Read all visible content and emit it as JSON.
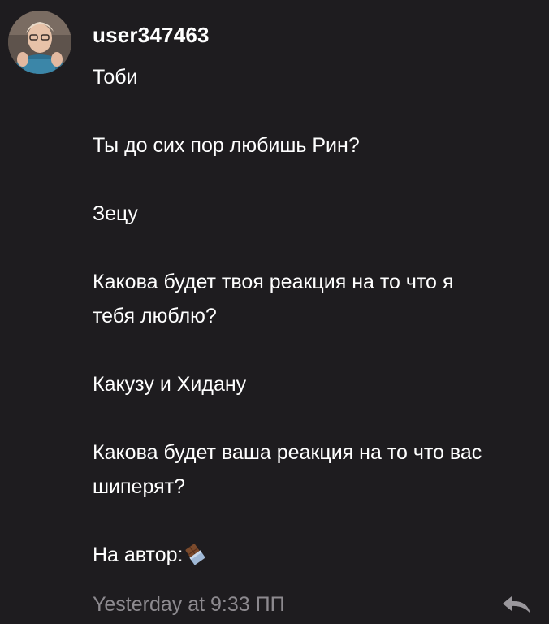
{
  "comment": {
    "username": "user347463",
    "lines": [
      "Тоби",
      "Ты до сих пор любишь Рин?",
      "Зецу",
      "Какова будет твоя реакция на то что я",
      "тебя люблю?",
      "Какузу и Хидану",
      "Какова будет ваша реакция на то что вас",
      "шиперят?",
      "На автор:"
    ],
    "trailing_emoji": "chocolate-bar-icon",
    "timestamp": "Yesterday at 9:33 ПП",
    "reply_icon": "reply-arrow-icon"
  },
  "colors": {
    "background": "#1e1c1f",
    "text": "#ffffff",
    "muted": "#8d8a8f"
  }
}
